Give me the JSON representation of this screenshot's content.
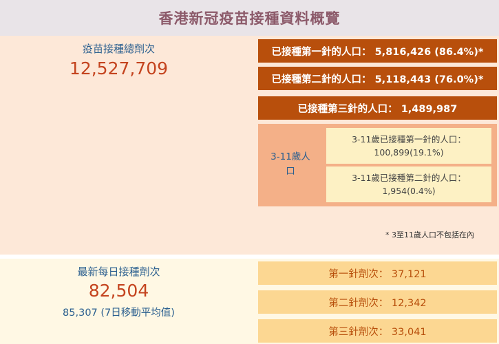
{
  "header": {
    "title": "香港新冠疫苗接種資料概覽"
  },
  "summary": {
    "total_label": "疫苗接種總劑次",
    "total_value": "12,527,709"
  },
  "population": {
    "first_dose": "已接種第一針的人口： 5,816,426 (86.4%)*",
    "second_dose": "已接種第二針的人口： 5,118,443 (76.0%)*",
    "third_dose": "已接種第三針的人口： 1,489,987"
  },
  "children": {
    "label": "3-11歲人口",
    "first_dose_label": "3-11歲已接種第一針的人口：",
    "first_dose_value": "100,899(19.1%)",
    "second_dose_label": "3-11歲已接種第二針的人口：",
    "second_dose_value": "1,954(0.4%)"
  },
  "footnote": "* 3至11歲人口不包括在內",
  "daily": {
    "label": "最新每日接種劑次",
    "value": "82,504",
    "average": "85,307 (7日移動平均值)"
  },
  "doses": {
    "first": "第一針劑次： 37,121",
    "second": "第二針劑次： 12,342",
    "third": "第三針劑次： 33,041"
  },
  "colors": {
    "dark_bar": "#b84f0c",
    "child_panel": "#f4b088",
    "child_box": "#fdf1c4",
    "dose_bar": "#fcd792",
    "highlight_number": "#c4441f",
    "label_blue": "#2b5f8f"
  }
}
